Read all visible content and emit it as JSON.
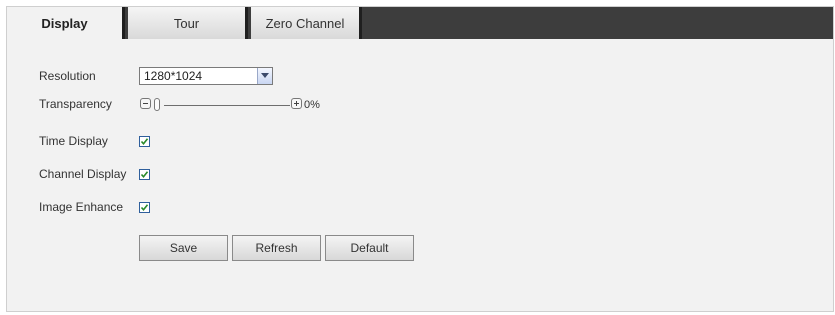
{
  "tabs": [
    {
      "label": "Display",
      "active": true
    },
    {
      "label": "Tour",
      "active": false
    },
    {
      "label": "Zero Channel",
      "active": false
    }
  ],
  "form": {
    "resolution": {
      "label": "Resolution",
      "value": "1280*1024"
    },
    "transparency": {
      "label": "Transparency",
      "value_text": "0%",
      "value": 0
    },
    "time_display": {
      "label": "Time Display",
      "checked": true
    },
    "channel_display": {
      "label": "Channel Display",
      "checked": true
    },
    "image_enhance": {
      "label": "Image Enhance",
      "checked": true
    }
  },
  "buttons": {
    "save": "Save",
    "refresh": "Refresh",
    "default": "Default"
  },
  "icons": {
    "minus": "minus-icon",
    "plus": "plus-icon",
    "dropdown": "chevron-down-icon",
    "check": "check-icon"
  },
  "colors": {
    "tab_bar": "#3d3d3d",
    "panel_bg": "#f2f2f2",
    "checkmark": "#2a8a2a"
  }
}
